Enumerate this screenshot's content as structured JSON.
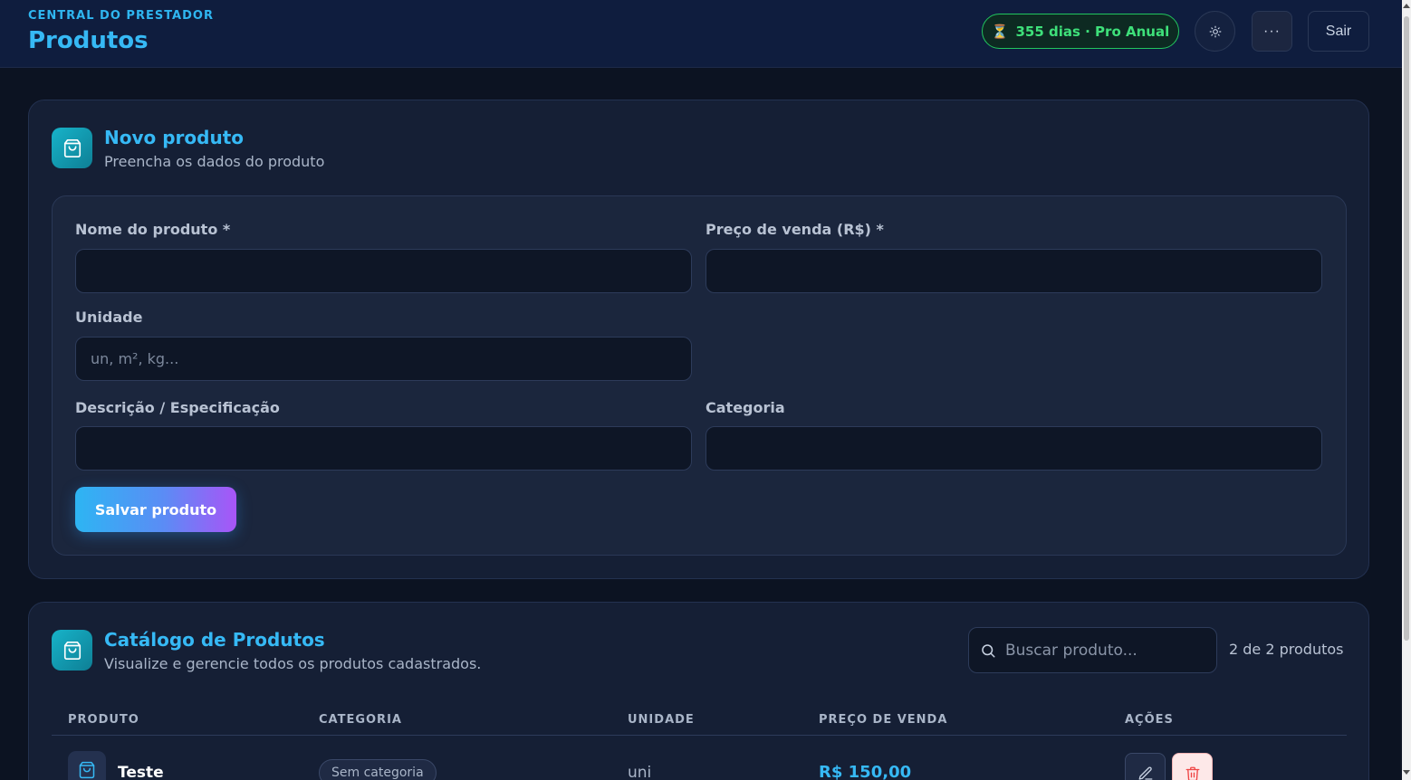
{
  "header": {
    "eyebrow": "CENTRAL DO PRESTADOR",
    "title": "Produtos",
    "plan_badge": "355 dias · Pro Anual",
    "more_label": "···",
    "logout_label": "Sair"
  },
  "form": {
    "title": "Novo produto",
    "subtitle": "Preencha os dados do produto",
    "name_label": "Nome do produto *",
    "name_value": "",
    "price_label": "Preço de venda (R$) *",
    "price_value": "",
    "unit_label": "Unidade",
    "unit_placeholder": "un, m², kg...",
    "description_label": "Descrição / Especificação",
    "description_value": "",
    "category_label": "Categoria",
    "category_value": "",
    "save_label": "Salvar produto"
  },
  "catalog": {
    "title": "Catálogo de Produtos",
    "subtitle": "Visualize e gerencie todos os produtos cadastrados.",
    "search_placeholder": "Buscar produto...",
    "count": "2 de 2 produtos",
    "columns": [
      "PRODUTO",
      "CATEGORIA",
      "UNIDADE",
      "PREÇO DE VENDA",
      "AÇÕES"
    ],
    "rows": [
      {
        "name": "Teste",
        "category": "Sem categoria",
        "unit": "uni",
        "price": "R$ 150,00"
      }
    ]
  },
  "colors": {
    "accent": "#36b9f5",
    "badge_green": "#22c55e",
    "danger": "#ef4444",
    "background": "#0c1322"
  },
  "icons": [
    "hourglass-icon",
    "sun-icon",
    "more-icon",
    "shopping-bag-icon",
    "search-icon",
    "edit-icon",
    "trash-icon"
  ]
}
